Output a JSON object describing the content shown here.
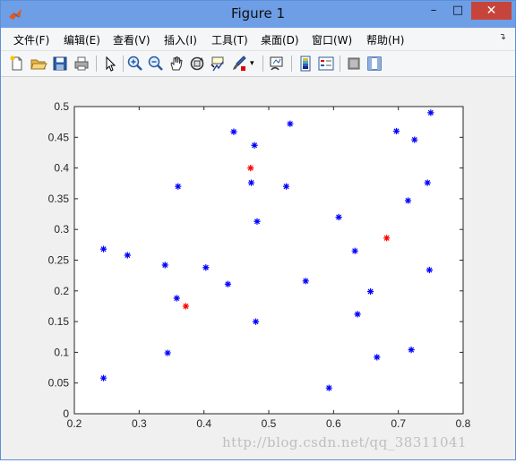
{
  "window": {
    "title": "Figure 1",
    "min_label": "–",
    "max_label": "□",
    "close_label": "✕"
  },
  "menu": {
    "items": [
      "文件(F)",
      "编辑(E)",
      "查看(V)",
      "插入(I)",
      "工具(T)",
      "桌面(D)",
      "窗口(W)",
      "帮助(H)"
    ],
    "overflow_glyph": "↴"
  },
  "toolbar": {
    "icons": [
      "new-figure-icon",
      "open-file-icon",
      "save-icon",
      "print-icon",
      "pointer-icon",
      "zoom-in-icon",
      "zoom-out-icon",
      "pan-hand-icon",
      "rotate-3d-icon",
      "data-cursor-icon",
      "brush-icon",
      "link-plot-icon",
      "colorbar-icon",
      "legend-icon",
      "hide-plot-tools-icon",
      "show-plot-tools-icon"
    ]
  },
  "colors": {
    "blue_series": "#0000ff",
    "red_series": "#ff0000",
    "titlebar": "#6d9ee6",
    "close_button": "#c7443a"
  },
  "watermark": "http://blog.csdn.net/qq_38311041",
  "chart_data": {
    "type": "scatter",
    "marker": "*",
    "xlim": [
      0.2,
      0.8
    ],
    "ylim": [
      0,
      0.5
    ],
    "xticks": [
      "0.2",
      "0.3",
      "0.4",
      "0.5",
      "0.6",
      "0.7",
      "0.8"
    ],
    "yticks": [
      "0",
      "0.05",
      "0.1",
      "0.15",
      "0.2",
      "0.25",
      "0.3",
      "0.35",
      "0.4",
      "0.45",
      "0.5"
    ],
    "grid": false,
    "series": [
      {
        "color": "#0000ff",
        "points": [
          [
            0.245,
            0.268
          ],
          [
            0.245,
            0.058
          ],
          [
            0.282,
            0.258
          ],
          [
            0.34,
            0.242
          ],
          [
            0.344,
            0.099
          ],
          [
            0.358,
            0.188
          ],
          [
            0.36,
            0.37
          ],
          [
            0.403,
            0.238
          ],
          [
            0.437,
            0.211
          ],
          [
            0.446,
            0.459
          ],
          [
            0.473,
            0.376
          ],
          [
            0.478,
            0.437
          ],
          [
            0.48,
            0.15
          ],
          [
            0.482,
            0.313
          ],
          [
            0.527,
            0.37
          ],
          [
            0.533,
            0.472
          ],
          [
            0.557,
            0.216
          ],
          [
            0.593,
            0.042
          ],
          [
            0.608,
            0.32
          ],
          [
            0.633,
            0.265
          ],
          [
            0.637,
            0.162
          ],
          [
            0.657,
            0.199
          ],
          [
            0.667,
            0.092
          ],
          [
            0.697,
            0.46
          ],
          [
            0.715,
            0.347
          ],
          [
            0.72,
            0.104
          ],
          [
            0.725,
            0.446
          ],
          [
            0.745,
            0.376
          ],
          [
            0.748,
            0.234
          ],
          [
            0.75,
            0.49
          ]
        ]
      },
      {
        "color": "#ff0000",
        "points": [
          [
            0.372,
            0.175
          ],
          [
            0.472,
            0.4
          ],
          [
            0.682,
            0.286
          ]
        ]
      }
    ]
  }
}
